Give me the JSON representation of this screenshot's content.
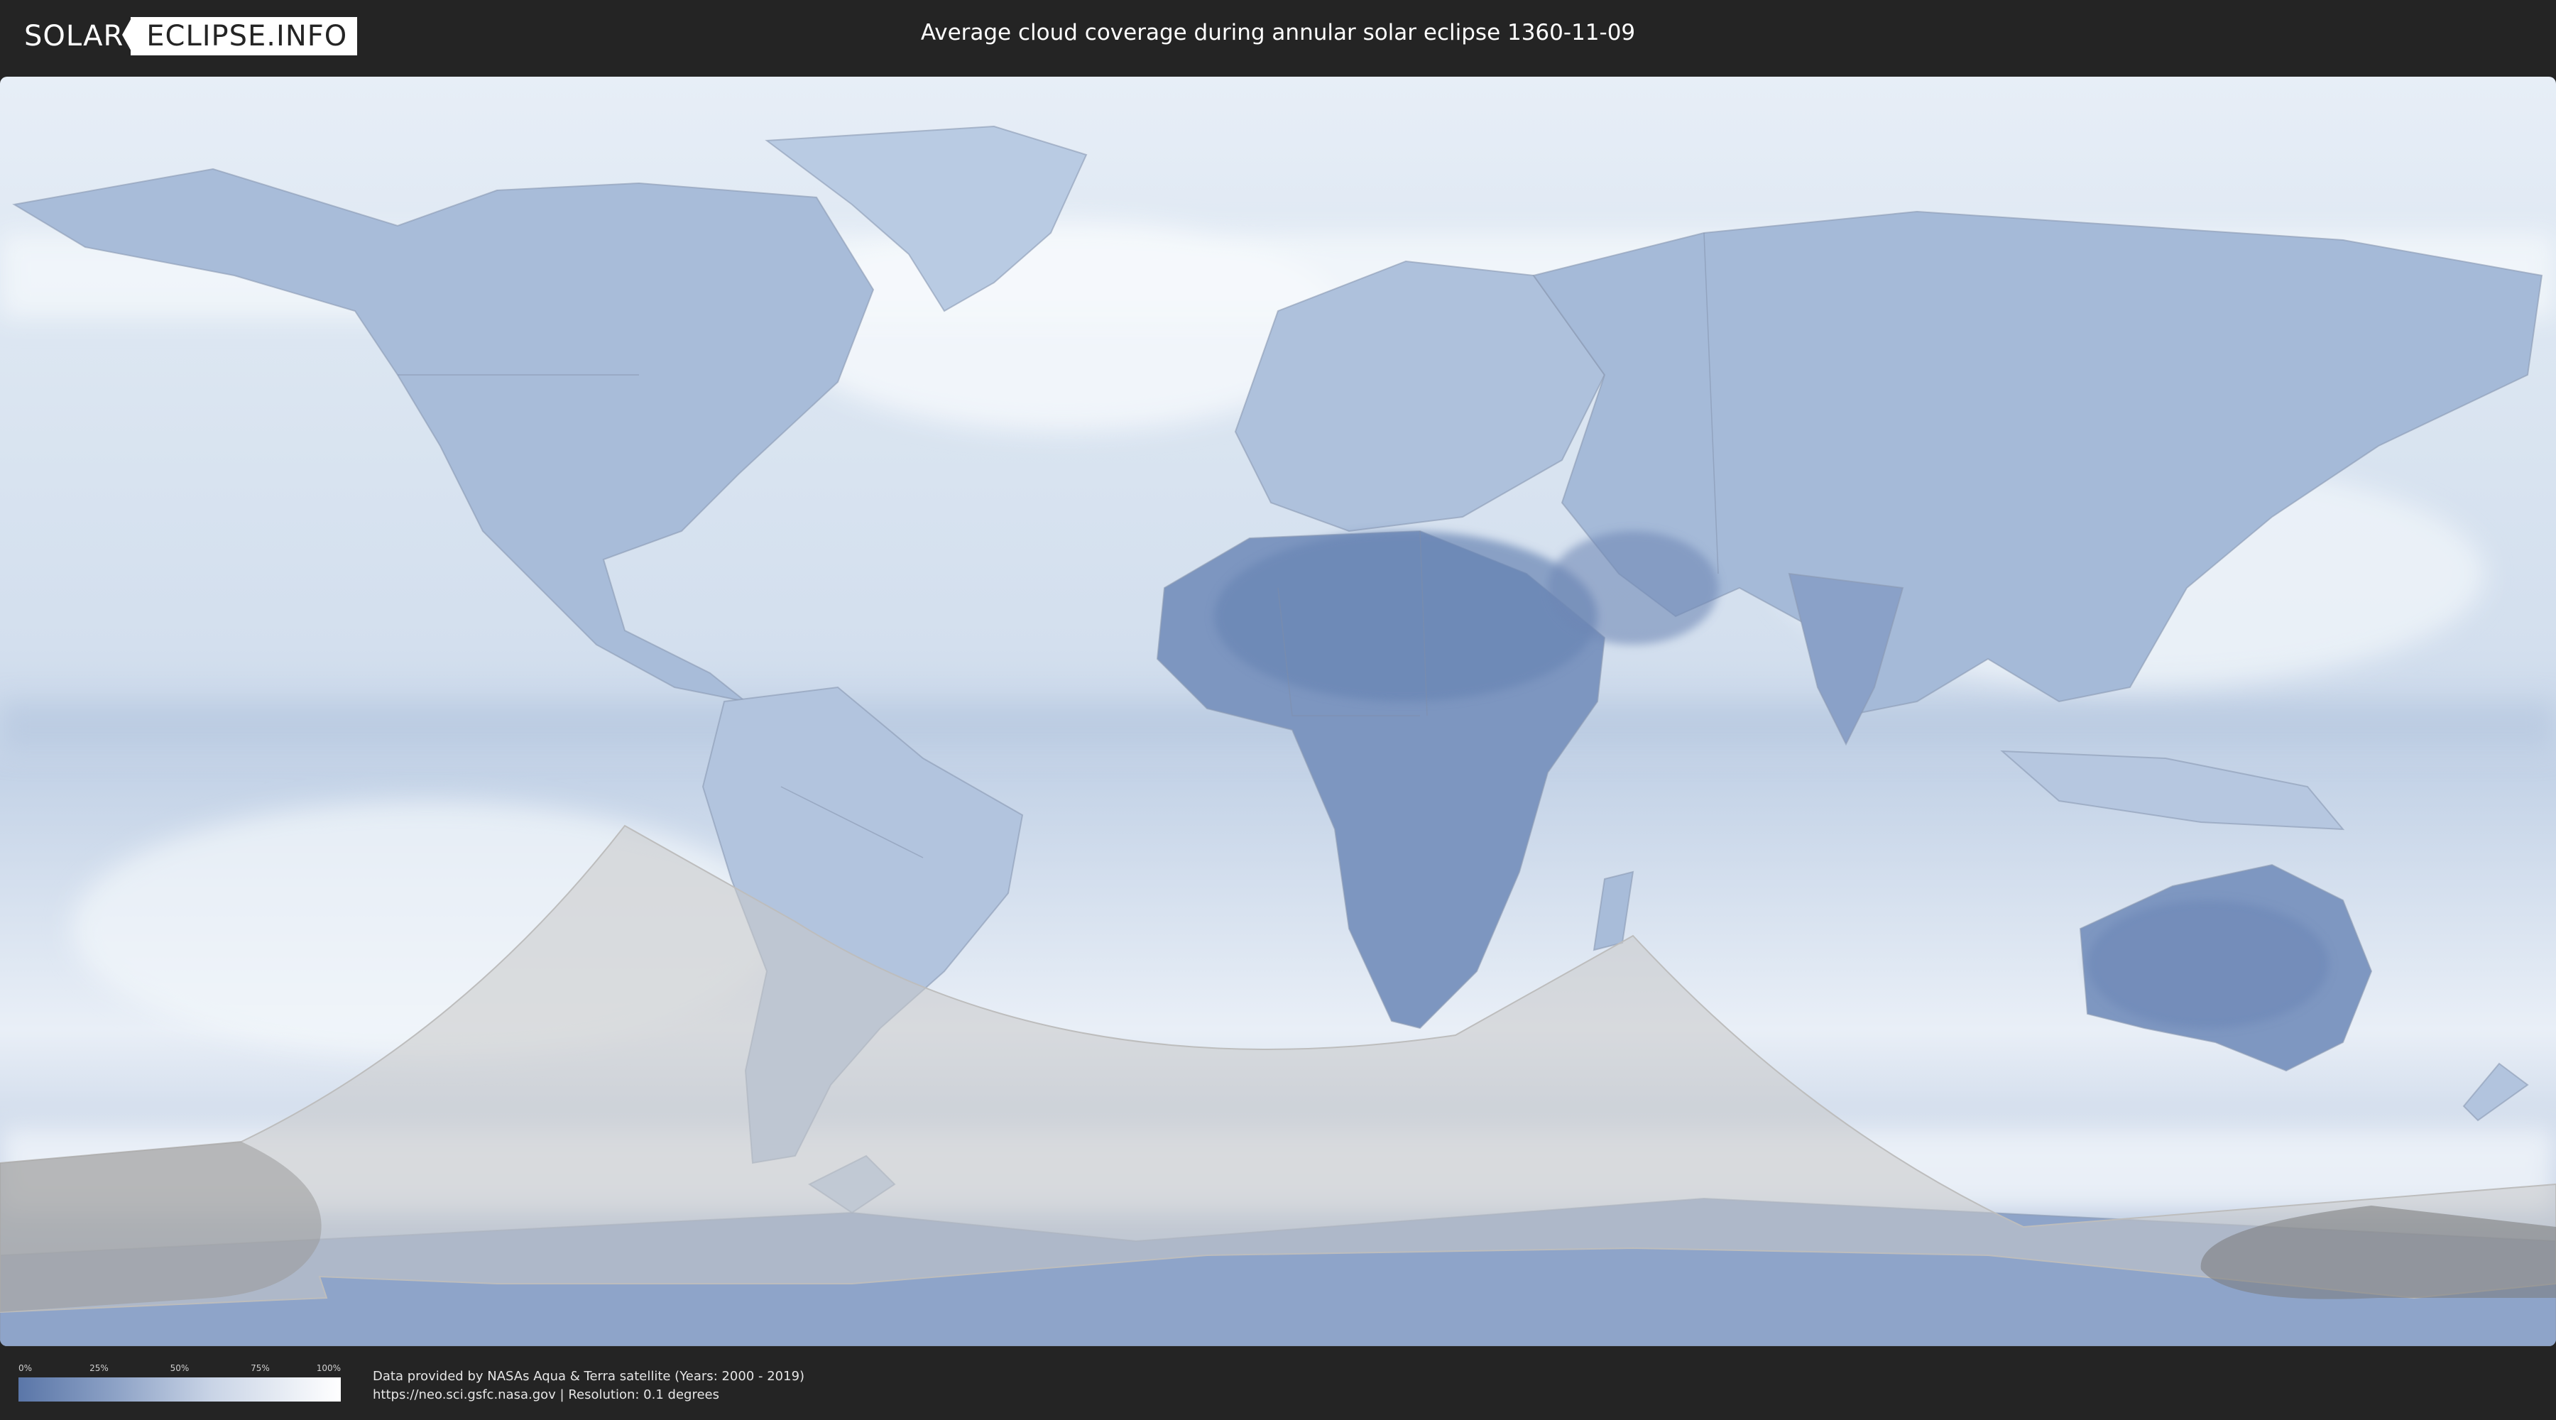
{
  "header": {
    "logo_part1": "SOLAR",
    "logo_part2": "ECLIPSE.INFO",
    "title": "Average cloud coverage during annular solar eclipse 1360-11-09"
  },
  "legend": {
    "labels": [
      "0%",
      "25%",
      "50%",
      "75%",
      "100%"
    ],
    "colors": {
      "min": "#5a76a8",
      "max": "#ffffff"
    }
  },
  "footer": {
    "line1": "Data provided by NASAs Aqua & Terra satellite (Years: 2000 - 2019)",
    "line2": "https://neo.sci.gsfc.nasa.gov | Resolution: 0.1 degrees"
  },
  "colors": {
    "background": "#242424",
    "cloud_high": "#eef3f9",
    "cloud_low": "#6f8bb8",
    "eclipse_overlay": "#c8c8c8"
  }
}
